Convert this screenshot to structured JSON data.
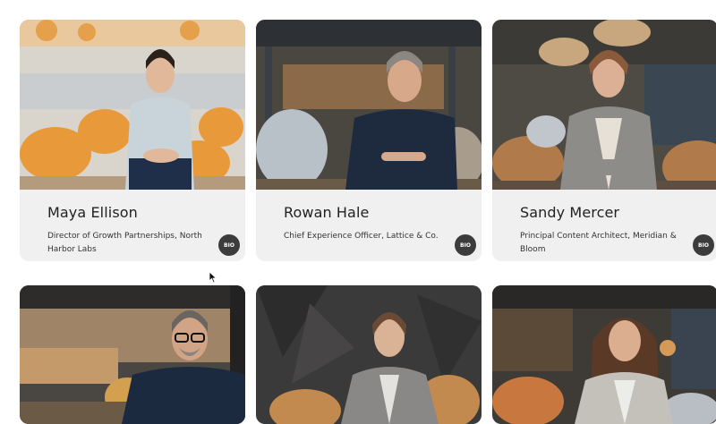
{
  "team": [
    {
      "name": "Maya Ellison",
      "title": "Director of Growth Partnerships, North Harbor Labs",
      "bio_label": "BIO"
    },
    {
      "name": "Rowan Hale",
      "title": "Chief Experience Officer, Lattice & Co.",
      "bio_label": "BIO"
    },
    {
      "name": "Sandy Mercer",
      "title": "Principal Content Architect, Meridian & Bloom",
      "bio_label": "BIO"
    },
    {
      "name": "",
      "title": "",
      "bio_label": ""
    },
    {
      "name": "",
      "title": "",
      "bio_label": ""
    },
    {
      "name": "",
      "title": "",
      "bio_label": ""
    }
  ],
  "colors": {
    "card_bg": "#f0f0f0",
    "bio_button": "#3c3c3c",
    "chair_orange": "#e89a3a"
  }
}
